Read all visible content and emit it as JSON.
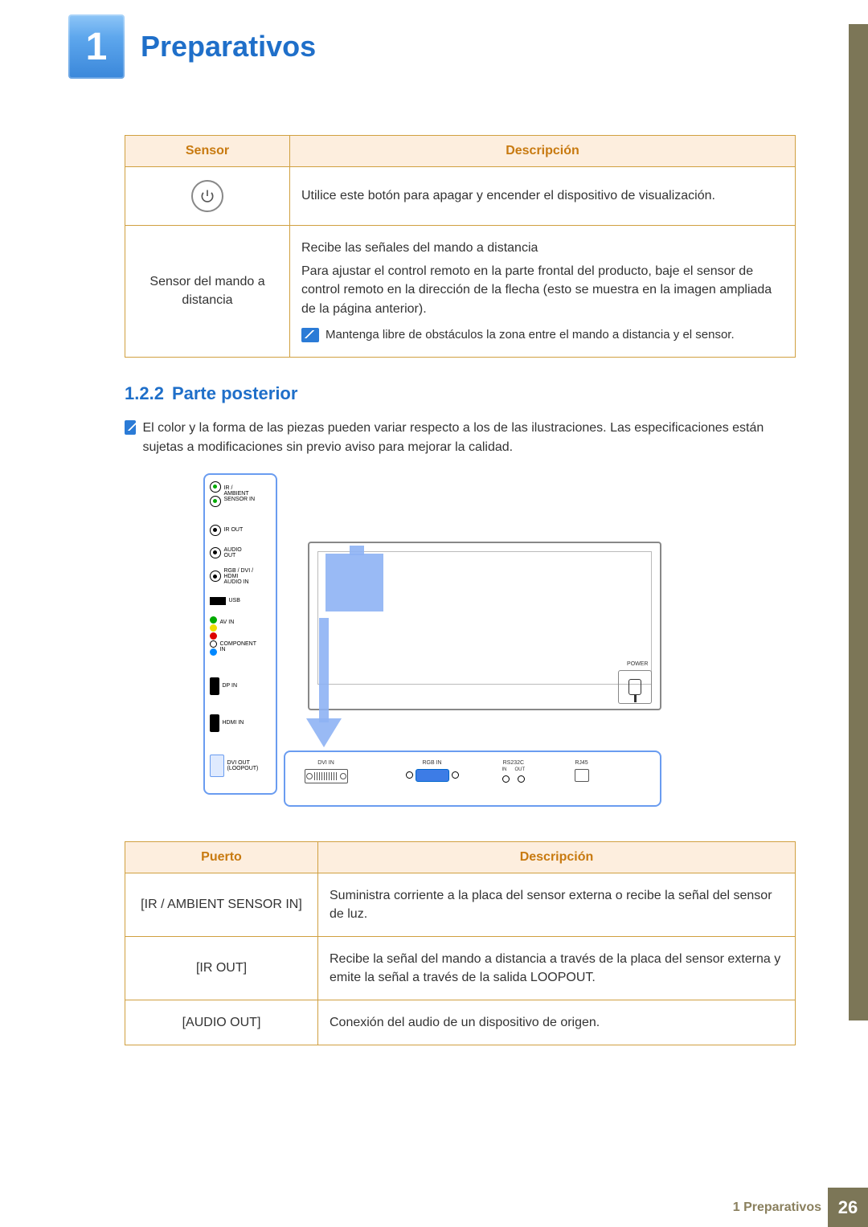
{
  "chapter_number": "1",
  "chapter_title": "Preparativos",
  "table1": {
    "header_sensor": "Sensor",
    "header_desc": "Descripción",
    "row1": {
      "desc": "Utilice este botón para apagar y encender el dispositivo de visualización."
    },
    "row2": {
      "sensor": "Sensor del mando a distancia",
      "p1": "Recibe las señales del mando a distancia",
      "p2": "Para ajustar el control remoto en la parte frontal del producto, baje el sensor de control remoto en la dirección de la flecha (esto se muestra en la imagen ampliada de la página anterior).",
      "note": "Mantenga libre de obstáculos la zona entre el mando a distancia y el sensor."
    }
  },
  "section": {
    "num": "1.2.2",
    "title": "Parte posterior"
  },
  "intro_note": "El color y la forma de las piezas pueden variar respecto a los de las ilustraciones. Las especificaciones están sujetas a modificaciones sin previo aviso para mejorar la calidad.",
  "diagram": {
    "ports_left": {
      "ir_ambient": "IR /\nAMBIENT\nSENSOR IN",
      "ir_out": "IR OUT",
      "audio_out": "AUDIO\nOUT",
      "rgb_dvi_hdmi_audio_in": "RGB / DVI /\nHDMI\nAUDIO IN",
      "usb": "USB",
      "av_in": "AV IN",
      "component_in": "COMPONENT\nIN",
      "dp_in": "DP IN",
      "hdmi_in": "HDMI IN",
      "dvi_out": "DVI OUT\n(LOOPOUT)"
    },
    "ports_bottom": {
      "dvi_in": "DVI IN",
      "rgb_in": "RGB IN",
      "rs232c": "RS232C",
      "rs232c_in": "IN",
      "rs232c_out": "OUT",
      "rj45": "RJ45"
    },
    "power": "POWER"
  },
  "table2": {
    "header_port": "Puerto",
    "header_desc": "Descripción",
    "rows": [
      {
        "port": "[IR / AMBIENT SENSOR IN]",
        "desc": "Suministra corriente a la placa del sensor externa o recibe la señal del sensor de luz."
      },
      {
        "port": "[IR OUT]",
        "desc": "Recibe la señal del mando a distancia a través de la placa del sensor externa y emite la señal a través de la salida LOOPOUT."
      },
      {
        "port": "[AUDIO OUT]",
        "desc": "Conexión del audio de un dispositivo de origen."
      }
    ]
  },
  "footer": {
    "crumb": "1 Preparativos",
    "page": "26"
  }
}
